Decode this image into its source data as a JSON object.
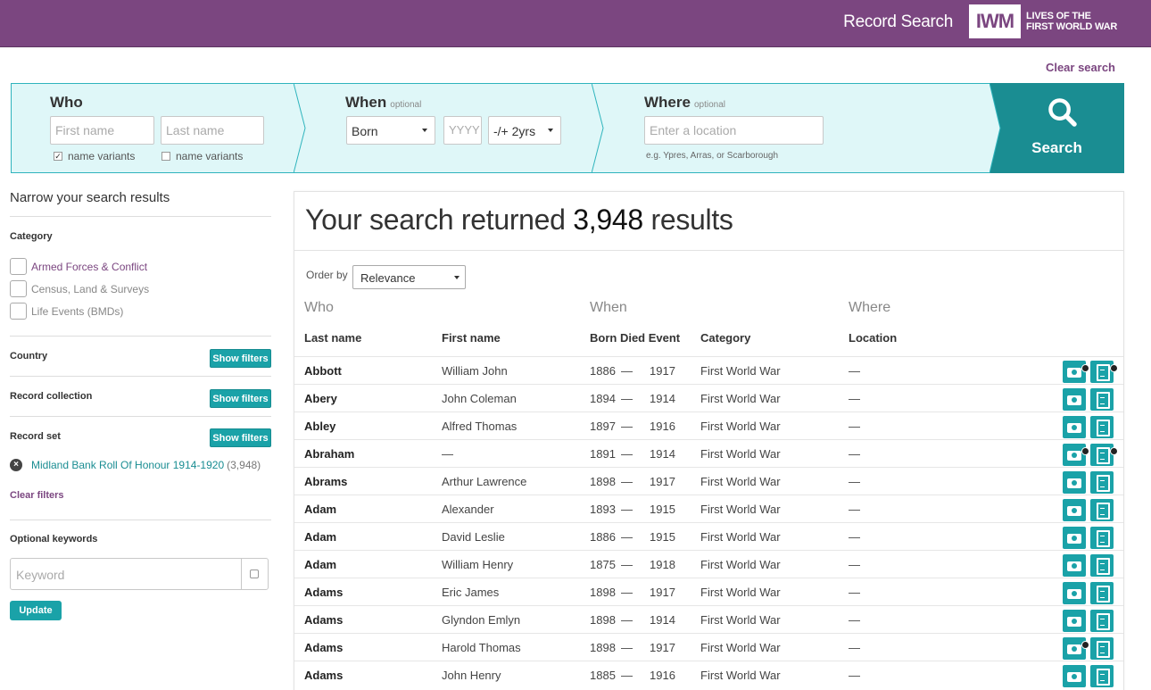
{
  "header": {
    "title": "Record Search",
    "logo_mark": "IWM",
    "logo_line1": "LIVES OF THE",
    "logo_line2": "FIRST WORLD WAR",
    "bg_color": "#7b4680"
  },
  "clear_search": "Clear search",
  "search": {
    "who": {
      "title": "Who",
      "first_name_placeholder": "First name",
      "last_name_placeholder": "Last name",
      "first_variants_label": "name variants",
      "first_variants_checked": true,
      "last_variants_label": "name variants",
      "last_variants_checked": false
    },
    "when": {
      "title": "When",
      "optional": "optional",
      "event_value": "Born",
      "year_placeholder": "YYYY",
      "range_value": "-/+ 2yrs"
    },
    "where": {
      "title": "Where",
      "optional": "optional",
      "location_placeholder": "Enter a location",
      "hint": "e.g. Ypres, Arras, or Scarborough"
    },
    "button_label": "Search",
    "accent": "#1a8d92"
  },
  "sidebar": {
    "narrow_title": "Narrow your search results",
    "category_heading": "Category",
    "categories": [
      "Armed Forces & Conflict",
      "Census, Land & Surveys",
      "Life Events (BMDs)"
    ],
    "country_heading": "Country",
    "record_collection_heading": "Record collection",
    "record_set_heading": "Record set",
    "show_filters": "Show filters",
    "active_filter_label": "Midland Bank Roll Of Honour 1914-1920",
    "active_filter_count": "(3,948)",
    "clear_filters": "Clear filters",
    "keywords_heading": "Optional keywords",
    "keyword_placeholder": "Keyword",
    "update_label": "Update"
  },
  "results": {
    "heading_prefix": "Your search returned",
    "count": "3,948",
    "heading_suffix": "results",
    "order_by_label": "Order by",
    "order_by_value": "Relevance",
    "groups": {
      "who": "Who",
      "when": "When",
      "where": "Where"
    },
    "columns": {
      "last_name": "Last name",
      "first_name": "First name",
      "born_died_event": "Born Died Event",
      "category": "Category",
      "location": "Location"
    },
    "dash": "—",
    "rows": [
      {
        "last": "Abbott",
        "first": "William John",
        "born": "1886",
        "died": "1917",
        "category": "First World War",
        "location": "—",
        "photo_tick": true,
        "doc_tick": true
      },
      {
        "last": "Abery",
        "first": "John Coleman",
        "born": "1894",
        "died": "1914",
        "category": "First World War",
        "location": "—",
        "photo_tick": false,
        "doc_tick": false
      },
      {
        "last": "Abley",
        "first": "Alfred Thomas",
        "born": "1897",
        "died": "1916",
        "category": "First World War",
        "location": "—",
        "photo_tick": false,
        "doc_tick": false
      },
      {
        "last": "Abraham",
        "first": "—",
        "born": "1891",
        "died": "1914",
        "category": "First World War",
        "location": "—",
        "photo_tick": true,
        "doc_tick": true
      },
      {
        "last": "Abrams",
        "first": "Arthur Lawrence",
        "born": "1898",
        "died": "1917",
        "category": "First World War",
        "location": "—",
        "photo_tick": false,
        "doc_tick": false
      },
      {
        "last": "Adam",
        "first": "Alexander",
        "born": "1893",
        "died": "1915",
        "category": "First World War",
        "location": "—",
        "photo_tick": false,
        "doc_tick": false
      },
      {
        "last": "Adam",
        "first": "David Leslie",
        "born": "1886",
        "died": "1915",
        "category": "First World War",
        "location": "—",
        "photo_tick": false,
        "doc_tick": false
      },
      {
        "last": "Adam",
        "first": "William Henry",
        "born": "1875",
        "died": "1918",
        "category": "First World War",
        "location": "—",
        "photo_tick": false,
        "doc_tick": false
      },
      {
        "last": "Adams",
        "first": "Eric James",
        "born": "1898",
        "died": "1917",
        "category": "First World War",
        "location": "—",
        "photo_tick": false,
        "doc_tick": false
      },
      {
        "last": "Adams",
        "first": "Glyndon Emlyn",
        "born": "1898",
        "died": "1914",
        "category": "First World War",
        "location": "—",
        "photo_tick": false,
        "doc_tick": false
      },
      {
        "last": "Adams",
        "first": "Harold Thomas",
        "born": "1898",
        "died": "1917",
        "category": "First World War",
        "location": "—",
        "photo_tick": true,
        "doc_tick": false
      },
      {
        "last": "Adams",
        "first": "John Henry",
        "born": "1885",
        "died": "1916",
        "category": "First World War",
        "location": "—",
        "photo_tick": false,
        "doc_tick": false
      }
    ]
  }
}
